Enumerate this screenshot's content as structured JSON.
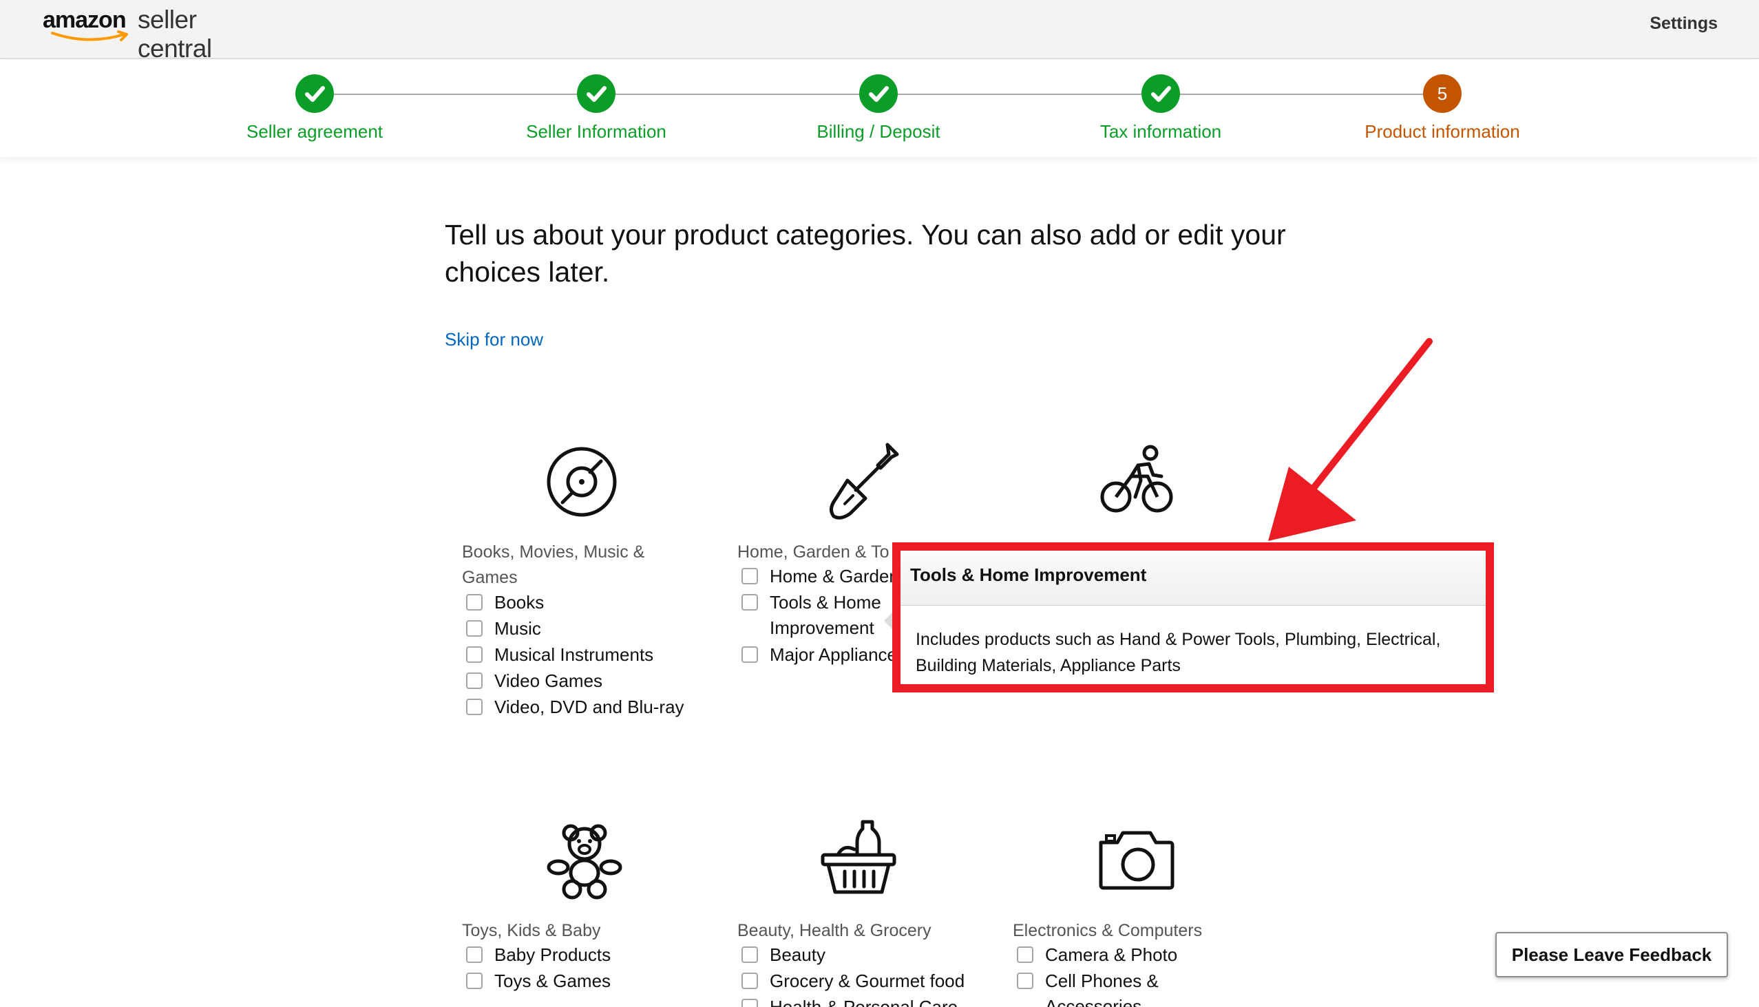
{
  "header": {
    "logo_brand": "amazon",
    "logo_product": "seller central",
    "settings_label": "Settings"
  },
  "stepper": {
    "steps": [
      {
        "label": "Seller agreement",
        "status": "done"
      },
      {
        "label": "Seller Information",
        "status": "done"
      },
      {
        "label": "Billing / Deposit",
        "status": "done"
      },
      {
        "label": "Tax information",
        "status": "done"
      },
      {
        "label": "Product information",
        "status": "current",
        "number": "5"
      }
    ]
  },
  "main": {
    "heading": "Tell us about your product categories. You can also add or edit your choices later.",
    "skip_label": "Skip for now"
  },
  "categories": [
    {
      "icon": "disc-icon",
      "title": "Books, Movies, Music & Games",
      "options": [
        "Books",
        "Music",
        "Musical Instruments",
        "Video Games",
        "Video, DVD and Blu-ray"
      ]
    },
    {
      "icon": "shovel-icon",
      "title": "Home, Garden & To",
      "options": [
        "Home & Garden",
        "Tools & Home Improvement",
        "Major Appliance"
      ]
    },
    {
      "icon": "bicycle-icon",
      "title": "",
      "options": []
    },
    {
      "icon": "teddy-bear-icon",
      "title": "Toys, Kids & Baby",
      "options": [
        "Baby Products",
        "Toys & Games"
      ]
    },
    {
      "icon": "grocery-basket-icon",
      "title": "Beauty, Health & Grocery",
      "options": [
        "Beauty",
        "Grocery & Gourmet food",
        "Health & Personal Care"
      ]
    },
    {
      "icon": "camera-icon",
      "title": "Electronics & Computers",
      "options": [
        "Camera & Photo",
        "Cell Phones & Accessories"
      ]
    }
  ],
  "popover": {
    "title": "Tools & Home Improvement",
    "body": "Includes products such as Hand & Power Tools, Plumbing, Electrical, Building Materials, Appliance Parts"
  },
  "feedback": {
    "label": "Please Leave Feedback"
  },
  "colors": {
    "done": "#0c9d28",
    "current": "#c45500",
    "link": "#0066c0",
    "highlight": "#ec1c24"
  }
}
